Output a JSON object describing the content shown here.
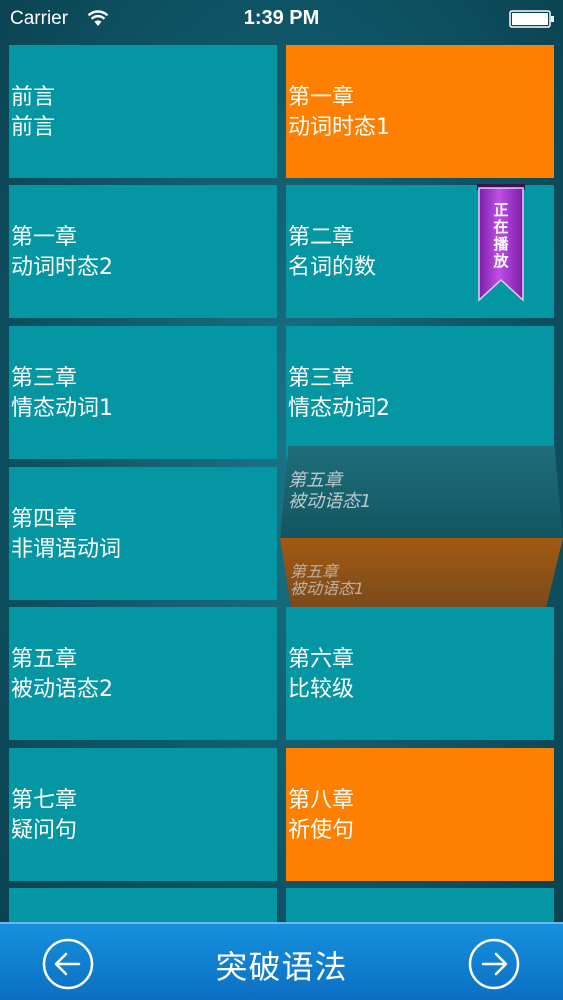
{
  "status_bar": {
    "carrier": "Carrier",
    "time": "1:39 PM",
    "icons": [
      "wifi-icon",
      "battery-icon"
    ]
  },
  "tiles": [
    {
      "line1": "前言",
      "line2": "前言",
      "color": "#0596a4"
    },
    {
      "line1": "第一章",
      "line2": "动词时态1",
      "color": "#ff8000"
    },
    {
      "line1": "第一章",
      "line2": "动词时态2",
      "color": "#0596a4"
    },
    {
      "line1": "第二章",
      "line2": "名词的数",
      "color": "#0596a4"
    },
    {
      "line1": "第三章",
      "line2": "情态动词1",
      "color": "#0596a4"
    },
    {
      "line1": "第三章",
      "line2": "情态动词2",
      "color": "#0596a4"
    },
    {
      "line1": "第四章",
      "line2": "非谓语动词",
      "color": "#0596a4"
    },
    {
      "line1": "第五章",
      "line2": "被动语态2",
      "color": "#0596a4"
    },
    {
      "line1": "第六章",
      "line2": "比较级",
      "color": "#0596a4"
    },
    {
      "line1": "第七章",
      "line2": "疑问句",
      "color": "#0596a4"
    },
    {
      "line1": "第八章",
      "line2": "祈使句",
      "color": "#ff8000"
    }
  ],
  "flipping_tile": {
    "line1": "第五章",
    "line2": "被动语态1"
  },
  "now_playing": {
    "label": "正在播放",
    "color": "#9b2fc9"
  },
  "bottom_bar": {
    "title": "突破语法",
    "back_icon": "arrow-left-circle-icon",
    "next_icon": "arrow-right-circle-icon",
    "color": "#1284d4"
  }
}
